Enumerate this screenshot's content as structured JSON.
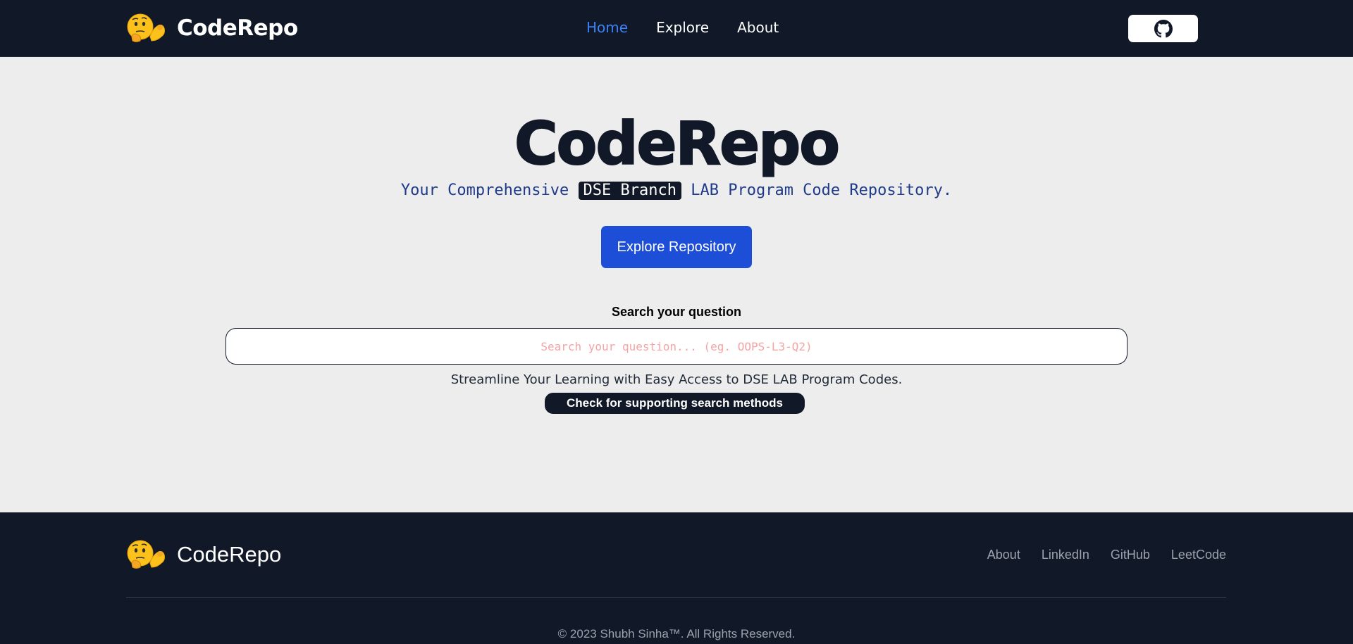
{
  "navbar": {
    "brand": "CodeRepo",
    "links": [
      {
        "label": "Home",
        "active": true
      },
      {
        "label": "Explore",
        "active": false
      },
      {
        "label": "About",
        "active": false
      }
    ],
    "github_icon": "github-icon"
  },
  "hero": {
    "title": "CodeRepo",
    "subtitle_before": "Your Comprehensive ",
    "subtitle_highlight": "DSE Branch",
    "subtitle_after": " LAB Program Code Repository.",
    "explore_button": "Explore Repository"
  },
  "search": {
    "label": "Search your question",
    "placeholder": "Search your question... (eg. OOPS-L3-Q2)",
    "value": "",
    "tagline": "Streamline Your Learning with Easy Access to DSE LAB Program Codes.",
    "support_button": "Check for supporting search methods"
  },
  "footer": {
    "brand": "CodeRepo",
    "links": [
      "About",
      "LinkedIn",
      "GitHub",
      "LeetCode"
    ],
    "copyright": "© 2023 Shubh Sinha™. All Rights Reserved."
  },
  "colors": {
    "navbar_bg": "#111827",
    "page_bg": "#ededed",
    "accent": "#3b82f6",
    "button_blue": "#1d4ed8",
    "subtitle_blue": "#1e3a8a",
    "placeholder": "#f5a3a3"
  },
  "icons": [
    "thinking-face-emoji-icon",
    "flexed-biceps-emoji-icon",
    "github-icon"
  ]
}
